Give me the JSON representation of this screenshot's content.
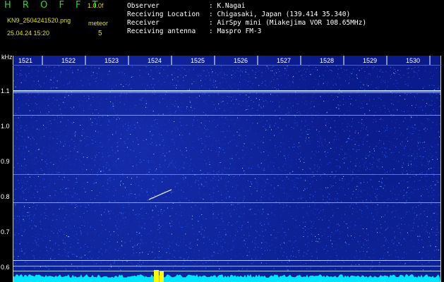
{
  "header": {
    "app_title": "H R O F F T",
    "version": "1.0.0f",
    "filename": "KN9_2504241520.png",
    "datetime": "25.04.24 15:20",
    "meteor_label": "meteor",
    "meteor_count": "5",
    "info": [
      {
        "key": "Observer",
        "value": ": K.Nagai"
      },
      {
        "key": "Receiving Location",
        "value": ": Chigasaki, Japan (139.414 35.340)"
      },
      {
        "key": "Receiver",
        "value": ": AirSpy mini (Miakejima VOR 108.65MHz)"
      },
      {
        "key": "Receiving antenna",
        "value": ": Maspro FM-3"
      }
    ]
  },
  "spectrogram": {
    "y_unit": "kHz",
    "x_ticks": [
      "1521",
      "1522",
      "1523",
      "1524",
      "1525",
      "1526",
      "1527",
      "1528",
      "1529",
      "1530"
    ],
    "y_ticks": [
      "1.1",
      "1.0",
      "0.9",
      "0.8",
      "0.7",
      "0.6"
    ],
    "colors": {
      "background": "#0c2296",
      "noise": "#3a6bff",
      "carrier": "#bfe6ff",
      "meteor": "#ffffff",
      "spectrum": "#00e5ff",
      "peak": "#ffff00"
    }
  }
}
